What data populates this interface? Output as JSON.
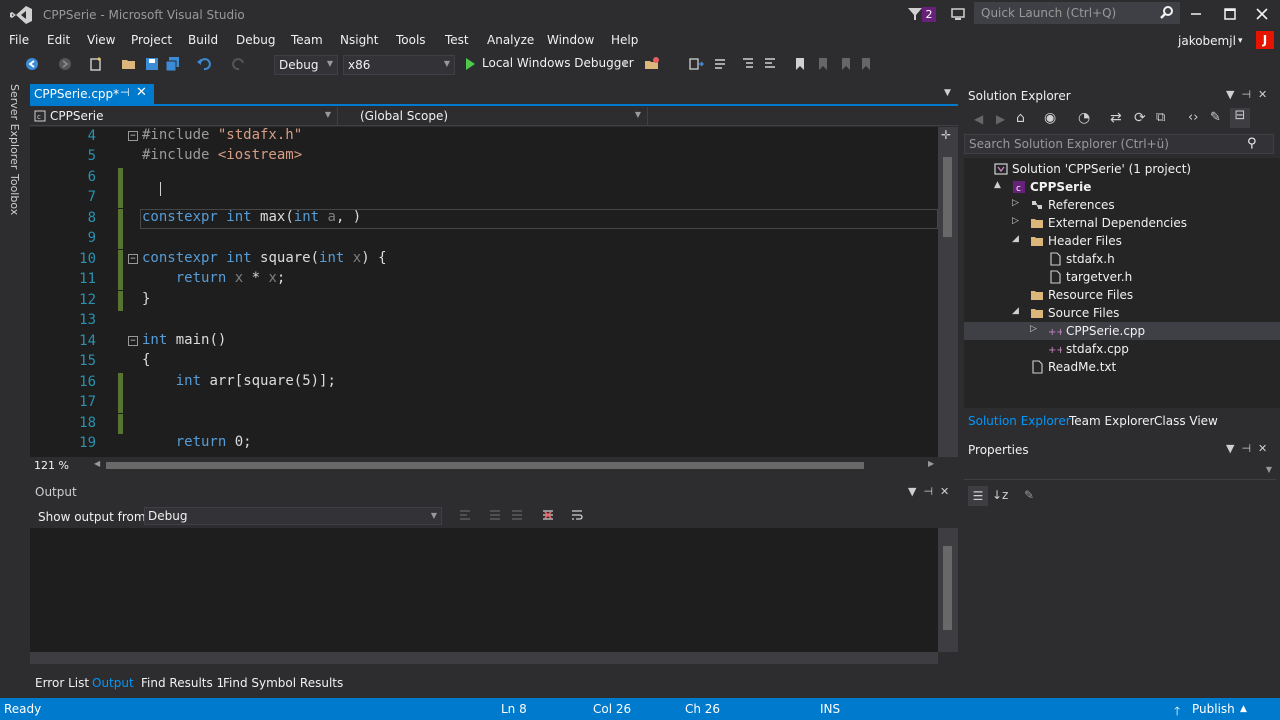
{
  "window": {
    "title": "CPPSerie - Microsoft Visual Studio",
    "notification_count": "2",
    "quick_launch_placeholder": "Quick Launch (Ctrl+Q)"
  },
  "menu": [
    "File",
    "Edit",
    "View",
    "Project",
    "Build",
    "Debug",
    "Team",
    "Nsight",
    "Tools",
    "Test",
    "Analyze",
    "Window",
    "Help"
  ],
  "user": {
    "name": "jakobemjl",
    "avatar_letter": "J"
  },
  "toolbar": {
    "configuration": "Debug",
    "platform": "x86",
    "debugger": "Local Windows Debugger"
  },
  "left_tabs": [
    "Server Explorer",
    "Toolbox"
  ],
  "editor": {
    "tab_label": "CPPSerie.cpp*",
    "nav_project": "CPPSerie",
    "nav_scope": "(Global Scope)",
    "zoom": "121 %",
    "lines": [
      {
        "num": "4",
        "text": "#include \"stdafx.h\""
      },
      {
        "num": "5",
        "text": "#include <iostream>"
      },
      {
        "num": "6",
        "text": ""
      },
      {
        "num": "7",
        "text": ""
      },
      {
        "num": "8",
        "text": "constexpr int max(int a, )"
      },
      {
        "num": "9",
        "text": ""
      },
      {
        "num": "10",
        "text": "constexpr int square(int x) {"
      },
      {
        "num": "11",
        "text": "    return x * x;"
      },
      {
        "num": "12",
        "text": "}"
      },
      {
        "num": "13",
        "text": ""
      },
      {
        "num": "14",
        "text": "int main()"
      },
      {
        "num": "15",
        "text": "{"
      },
      {
        "num": "16",
        "text": "    int arr[square(5)];"
      },
      {
        "num": "17",
        "text": ""
      },
      {
        "num": "18",
        "text": ""
      },
      {
        "num": "19",
        "text": "    return 0;"
      }
    ]
  },
  "output": {
    "title": "Output",
    "show_output_from_label": "Show output from:",
    "source": "Debug"
  },
  "bottom_tabs": [
    "Error List",
    "Output",
    "Find Results 1",
    "Find Symbol Results"
  ],
  "solution_explorer": {
    "title": "Solution Explorer",
    "search_placeholder": "Search Solution Explorer (Ctrl+ü)",
    "tree": [
      {
        "label": "Solution 'CPPSerie' (1 project)",
        "indent": 0,
        "arrow": "",
        "icon": "solution"
      },
      {
        "label": "CPPSerie",
        "indent": 1,
        "arrow": "▲",
        "icon": "project"
      },
      {
        "label": "References",
        "indent": 2,
        "arrow": "▷",
        "icon": "references"
      },
      {
        "label": "External Dependencies",
        "indent": 2,
        "arrow": "▷",
        "icon": "folder"
      },
      {
        "label": "Header Files",
        "indent": 2,
        "arrow": "◢",
        "icon": "folder"
      },
      {
        "label": "stdafx.h",
        "indent": 3,
        "arrow": "",
        "icon": "file"
      },
      {
        "label": "targetver.h",
        "indent": 3,
        "arrow": "",
        "icon": "file"
      },
      {
        "label": "Resource Files",
        "indent": 2,
        "arrow": "",
        "icon": "folder"
      },
      {
        "label": "Source Files",
        "indent": 2,
        "arrow": "◢",
        "icon": "folder"
      },
      {
        "label": "CPPSerie.cpp",
        "indent": 3,
        "arrow": "▷",
        "icon": "cpp"
      },
      {
        "label": "stdafx.cpp",
        "indent": 3,
        "arrow": "",
        "icon": "cpp"
      },
      {
        "label": "ReadMe.txt",
        "indent": 2,
        "arrow": "",
        "icon": "file"
      }
    ],
    "tabs": [
      "Solution Explorer",
      "Team Explorer",
      "Class View"
    ]
  },
  "properties": {
    "title": "Properties"
  },
  "status": {
    "ready": "Ready",
    "line": "Ln 8",
    "col": "Col 26",
    "ch": "Ch 26",
    "ins": "INS",
    "publish": "Publish"
  },
  "colors": {
    "accent": "#007acc",
    "keyword": "#569cd6",
    "string": "#d69d85",
    "line_number": "#2b91af",
    "change_bar": "#577430"
  }
}
